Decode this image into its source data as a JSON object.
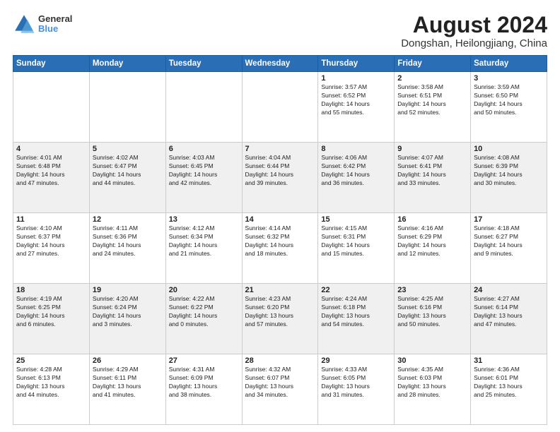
{
  "header": {
    "logo_general": "General",
    "logo_blue": "Blue",
    "title": "August 2024",
    "subtitle": "Dongshan, Heilongjiang, China"
  },
  "weekdays": [
    "Sunday",
    "Monday",
    "Tuesday",
    "Wednesday",
    "Thursday",
    "Friday",
    "Saturday"
  ],
  "weeks": [
    [
      {
        "day": "",
        "info": ""
      },
      {
        "day": "",
        "info": ""
      },
      {
        "day": "",
        "info": ""
      },
      {
        "day": "",
        "info": ""
      },
      {
        "day": "1",
        "info": "Sunrise: 3:57 AM\nSunset: 6:52 PM\nDaylight: 14 hours\nand 55 minutes."
      },
      {
        "day": "2",
        "info": "Sunrise: 3:58 AM\nSunset: 6:51 PM\nDaylight: 14 hours\nand 52 minutes."
      },
      {
        "day": "3",
        "info": "Sunrise: 3:59 AM\nSunset: 6:50 PM\nDaylight: 14 hours\nand 50 minutes."
      }
    ],
    [
      {
        "day": "4",
        "info": "Sunrise: 4:01 AM\nSunset: 6:48 PM\nDaylight: 14 hours\nand 47 minutes."
      },
      {
        "day": "5",
        "info": "Sunrise: 4:02 AM\nSunset: 6:47 PM\nDaylight: 14 hours\nand 44 minutes."
      },
      {
        "day": "6",
        "info": "Sunrise: 4:03 AM\nSunset: 6:45 PM\nDaylight: 14 hours\nand 42 minutes."
      },
      {
        "day": "7",
        "info": "Sunrise: 4:04 AM\nSunset: 6:44 PM\nDaylight: 14 hours\nand 39 minutes."
      },
      {
        "day": "8",
        "info": "Sunrise: 4:06 AM\nSunset: 6:42 PM\nDaylight: 14 hours\nand 36 minutes."
      },
      {
        "day": "9",
        "info": "Sunrise: 4:07 AM\nSunset: 6:41 PM\nDaylight: 14 hours\nand 33 minutes."
      },
      {
        "day": "10",
        "info": "Sunrise: 4:08 AM\nSunset: 6:39 PM\nDaylight: 14 hours\nand 30 minutes."
      }
    ],
    [
      {
        "day": "11",
        "info": "Sunrise: 4:10 AM\nSunset: 6:37 PM\nDaylight: 14 hours\nand 27 minutes."
      },
      {
        "day": "12",
        "info": "Sunrise: 4:11 AM\nSunset: 6:36 PM\nDaylight: 14 hours\nand 24 minutes."
      },
      {
        "day": "13",
        "info": "Sunrise: 4:12 AM\nSunset: 6:34 PM\nDaylight: 14 hours\nand 21 minutes."
      },
      {
        "day": "14",
        "info": "Sunrise: 4:14 AM\nSunset: 6:32 PM\nDaylight: 14 hours\nand 18 minutes."
      },
      {
        "day": "15",
        "info": "Sunrise: 4:15 AM\nSunset: 6:31 PM\nDaylight: 14 hours\nand 15 minutes."
      },
      {
        "day": "16",
        "info": "Sunrise: 4:16 AM\nSunset: 6:29 PM\nDaylight: 14 hours\nand 12 minutes."
      },
      {
        "day": "17",
        "info": "Sunrise: 4:18 AM\nSunset: 6:27 PM\nDaylight: 14 hours\nand 9 minutes."
      }
    ],
    [
      {
        "day": "18",
        "info": "Sunrise: 4:19 AM\nSunset: 6:25 PM\nDaylight: 14 hours\nand 6 minutes."
      },
      {
        "day": "19",
        "info": "Sunrise: 4:20 AM\nSunset: 6:24 PM\nDaylight: 14 hours\nand 3 minutes."
      },
      {
        "day": "20",
        "info": "Sunrise: 4:22 AM\nSunset: 6:22 PM\nDaylight: 14 hours\nand 0 minutes."
      },
      {
        "day": "21",
        "info": "Sunrise: 4:23 AM\nSunset: 6:20 PM\nDaylight: 13 hours\nand 57 minutes."
      },
      {
        "day": "22",
        "info": "Sunrise: 4:24 AM\nSunset: 6:18 PM\nDaylight: 13 hours\nand 54 minutes."
      },
      {
        "day": "23",
        "info": "Sunrise: 4:25 AM\nSunset: 6:16 PM\nDaylight: 13 hours\nand 50 minutes."
      },
      {
        "day": "24",
        "info": "Sunrise: 4:27 AM\nSunset: 6:14 PM\nDaylight: 13 hours\nand 47 minutes."
      }
    ],
    [
      {
        "day": "25",
        "info": "Sunrise: 4:28 AM\nSunset: 6:13 PM\nDaylight: 13 hours\nand 44 minutes."
      },
      {
        "day": "26",
        "info": "Sunrise: 4:29 AM\nSunset: 6:11 PM\nDaylight: 13 hours\nand 41 minutes."
      },
      {
        "day": "27",
        "info": "Sunrise: 4:31 AM\nSunset: 6:09 PM\nDaylight: 13 hours\nand 38 minutes."
      },
      {
        "day": "28",
        "info": "Sunrise: 4:32 AM\nSunset: 6:07 PM\nDaylight: 13 hours\nand 34 minutes."
      },
      {
        "day": "29",
        "info": "Sunrise: 4:33 AM\nSunset: 6:05 PM\nDaylight: 13 hours\nand 31 minutes."
      },
      {
        "day": "30",
        "info": "Sunrise: 4:35 AM\nSunset: 6:03 PM\nDaylight: 13 hours\nand 28 minutes."
      },
      {
        "day": "31",
        "info": "Sunrise: 4:36 AM\nSunset: 6:01 PM\nDaylight: 13 hours\nand 25 minutes."
      }
    ]
  ]
}
